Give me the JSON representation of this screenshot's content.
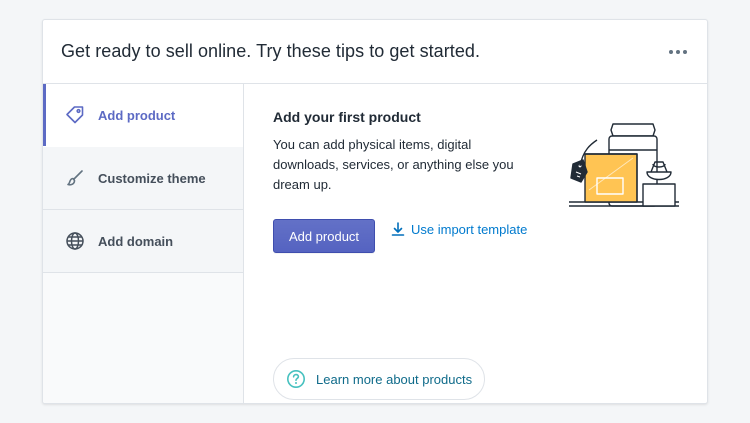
{
  "header": {
    "title": "Get ready to sell online. Try these tips to get started.",
    "more_icon": "horizontal-dots-icon"
  },
  "sidebar": {
    "items": [
      {
        "label": "Add product",
        "icon": "tag-icon",
        "active": true
      },
      {
        "label": "Customize theme",
        "icon": "paintbrush-icon",
        "active": false
      },
      {
        "label": "Add domain",
        "icon": "globe-icon",
        "active": false
      }
    ]
  },
  "main": {
    "title": "Add your first product",
    "description": "You can add physical items, digital downloads, services, or anything else you dream up.",
    "primary_button": "Add product",
    "import_link": "Use import template",
    "learn_more": "Learn more about products"
  },
  "colors": {
    "accent": "#5c6ac4",
    "link": "#007ace",
    "teal": "#47c1bf",
    "illustration_yellow": "#ffc453"
  }
}
